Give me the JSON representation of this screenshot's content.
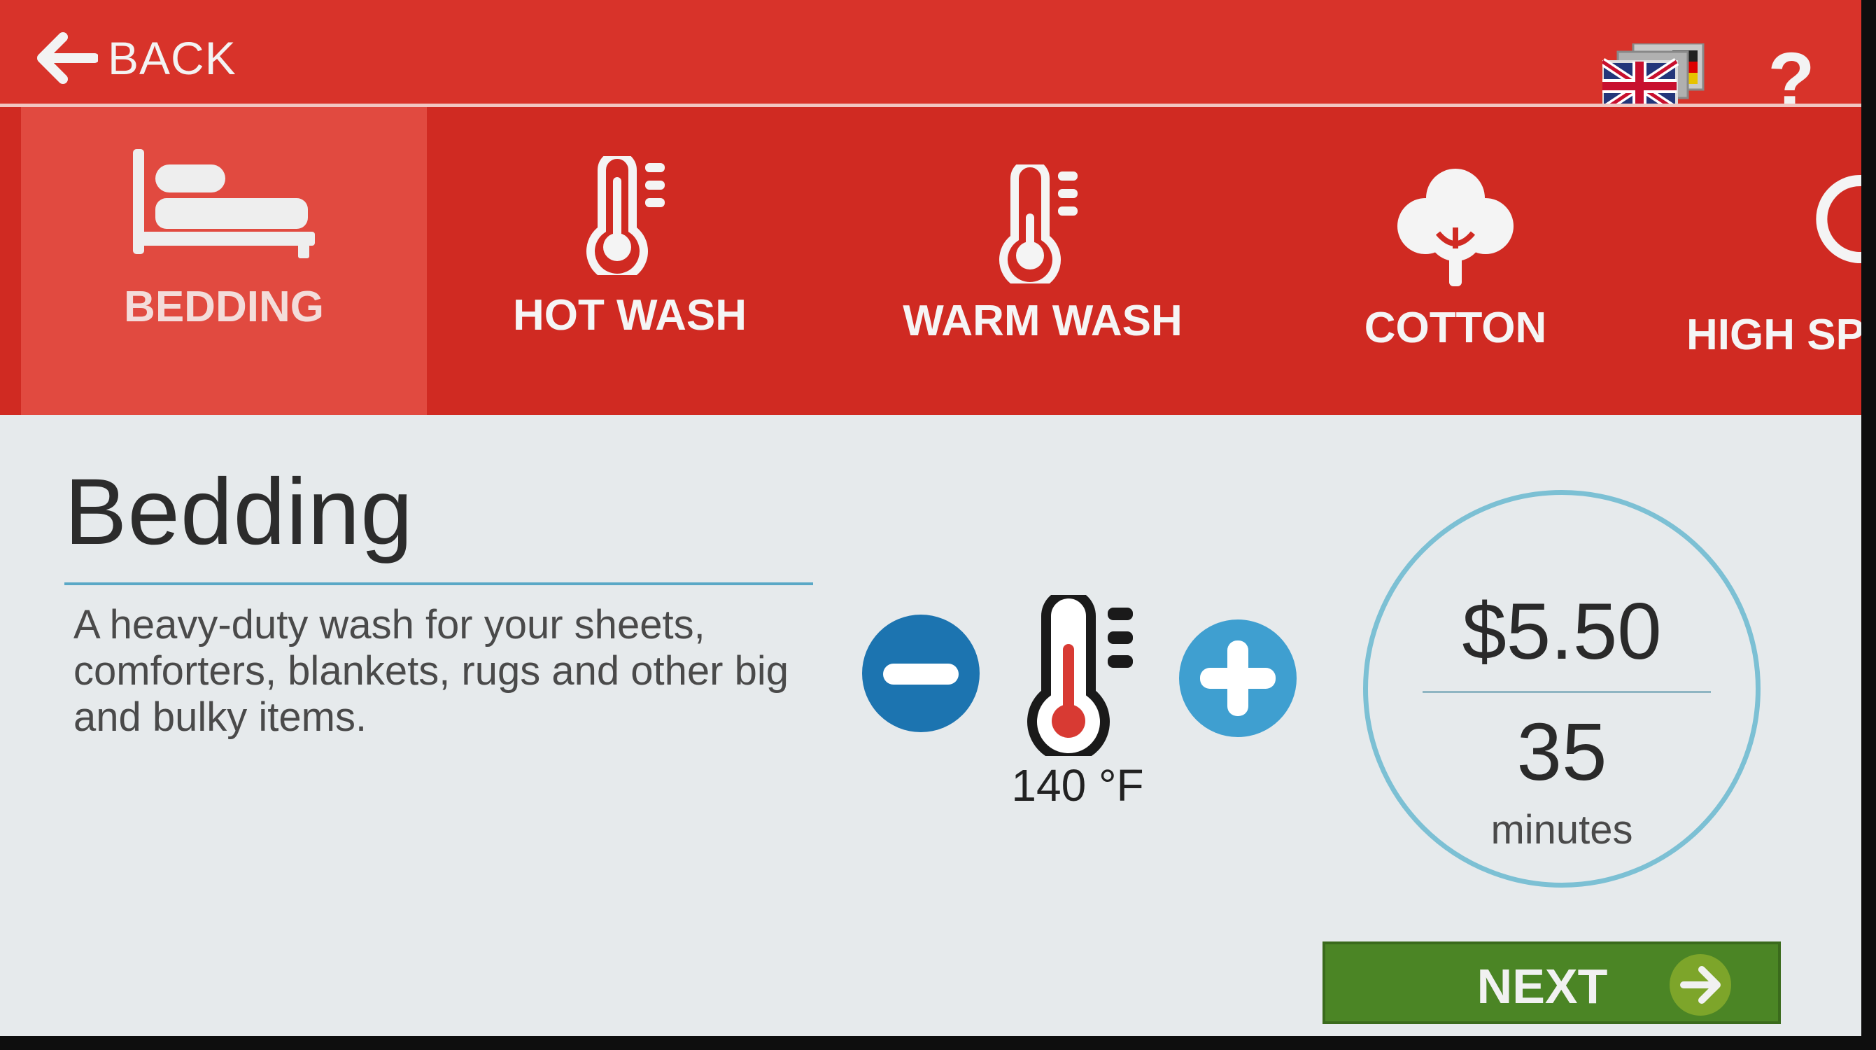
{
  "header": {
    "back_label": "BACK",
    "help_label": "?"
  },
  "tabs": [
    {
      "label": "BEDDING",
      "icon": "bed-icon",
      "active": true
    },
    {
      "label": "HOT WASH",
      "icon": "thermometer-hot-icon",
      "active": false
    },
    {
      "label": "WARM WASH",
      "icon": "thermometer-warm-icon",
      "active": false
    },
    {
      "label": "COTTON",
      "icon": "cotton-plant-icon",
      "active": false
    },
    {
      "label": "HIGH SP",
      "icon": "spin-icon",
      "active": false
    }
  ],
  "program": {
    "title": "Bedding",
    "description": "A heavy-duty wash for your sheets, comforters, blankets, rugs and other big and bulky items."
  },
  "temperature": {
    "value": "140 °F"
  },
  "summary": {
    "price": "$5.50",
    "duration": "35",
    "duration_unit": "minutes"
  },
  "actions": {
    "next_label": "NEXT"
  },
  "colors": {
    "header_red": "#d8332a",
    "tab_active": "#e14a40",
    "accent_blue": "#1c74b0",
    "next_green": "#4b8525",
    "circle_border": "#7cc0d4"
  }
}
